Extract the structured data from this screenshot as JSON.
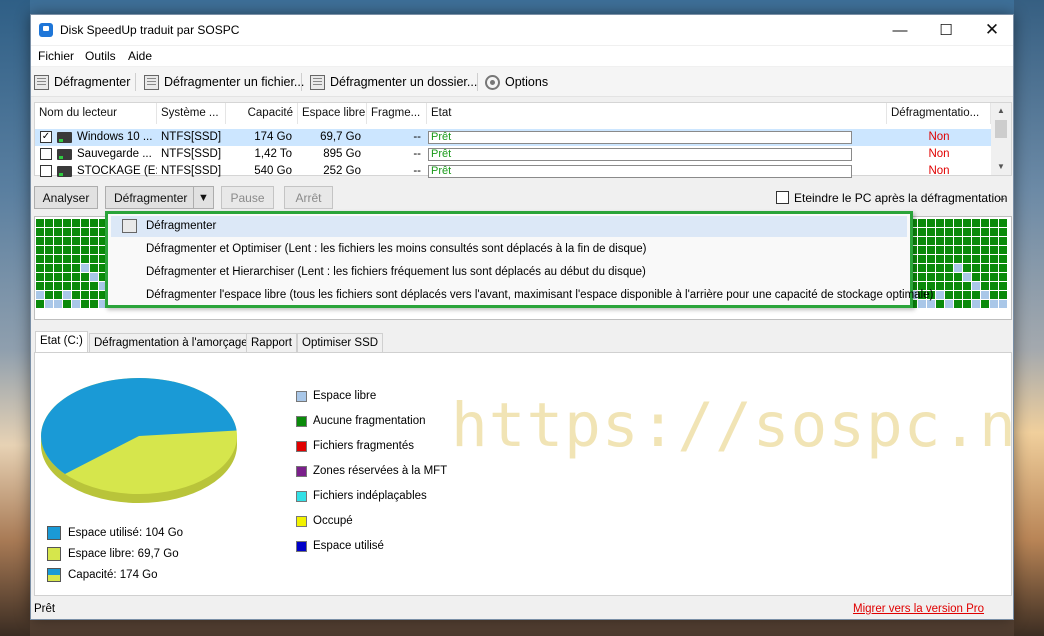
{
  "window": {
    "title": "Disk SpeedUp traduit par SOSPC"
  },
  "menu": [
    "Fichier",
    "Outils",
    "Aide"
  ],
  "toolbar": {
    "defrag": "Défragmenter",
    "defrag_file": "Défragmenter un fichier...",
    "defrag_folder": "Défragmenter un dossier...",
    "options": "Options"
  },
  "table": {
    "columns": [
      "Nom du lecteur",
      "Système ...",
      "Capacité",
      "Espace libre",
      "Fragme...",
      "Etat",
      "Défragmentatio..."
    ],
    "rows": [
      {
        "checked": true,
        "name": "Windows 10 ...",
        "fs": "NTFS[SSD]",
        "capacity": "174 Go",
        "free": "69,7 Go",
        "frag": "--",
        "state": "Prêt",
        "defrag": "Non"
      },
      {
        "checked": false,
        "name": "Sauvegarde ...",
        "fs": "NTFS[SSD]",
        "capacity": "1,42 To",
        "free": "895 Go",
        "frag": "--",
        "state": "Prêt",
        "defrag": "Non"
      },
      {
        "checked": false,
        "name": "STOCKAGE (E:)",
        "fs": "NTFS[SSD]",
        "capacity": "540 Go",
        "free": "252 Go",
        "frag": "--",
        "state": "Prêt",
        "defrag": "Non"
      }
    ]
  },
  "actions": {
    "analyze": "Analyser",
    "defrag": "Défragmenter",
    "pause": "Pause",
    "stop": "Arrêt",
    "shutdown_label": "Eteindre le PC après la défragmentation"
  },
  "dropdown": [
    "Défragmenter",
    "Défragmenter et Optimiser (Lent : les fichiers les moins consultés sont déplacés à la fin de disque)",
    "Défragmenter et Hierarchiser (Lent : les fichiers fréquement lus sont déplacés au début du disque)",
    "Défragmenter l'espace libre (tous les fichiers sont déplacés vers l'avant, maximisant l'espace disponible à l'arrière pour une capacité de stockage optimale)"
  ],
  "tabs": [
    "Etat (C:)",
    "Défragmentation à l'amorçage",
    "Rapport",
    "Optimiser SSD"
  ],
  "pie_legend": [
    {
      "label": "Espace utilisé: 104 Go",
      "color": "#1a9ad6"
    },
    {
      "label": "Espace libre: 69,7 Go",
      "color": "#d6e64c"
    },
    {
      "label": "Capacité: 174 Go",
      "color": "#1a9ad6"
    }
  ],
  "map_legend": [
    {
      "label": "Espace libre",
      "color": "#a9c7e8"
    },
    {
      "label": "Aucune fragmentation",
      "color": "#0a8a0a"
    },
    {
      "label": "Fichiers fragmentés",
      "color": "#e00000"
    },
    {
      "label": "Zones réservées à la MFT",
      "color": "#7a1f8a"
    },
    {
      "label": "Fichiers indéplaçables",
      "color": "#33e0e6"
    },
    {
      "label": "Occupé",
      "color": "#f2f200"
    },
    {
      "label": "Espace utilisé",
      "color": "#0000c8"
    }
  ],
  "chart_data": {
    "type": "pie",
    "series": [
      {
        "name": "Espace utilisé",
        "value": 104
      },
      {
        "name": "Espace libre",
        "value": 69.7
      }
    ]
  },
  "watermark": "https://sospc.name",
  "status": {
    "left": "Prêt",
    "link": "Migrer vers la version Pro"
  },
  "colors": {
    "accent_green": "#2aa43a",
    "map_green": "#0a8a0a",
    "map_free": "#a9c7e8",
    "link_red": "#e00000"
  }
}
